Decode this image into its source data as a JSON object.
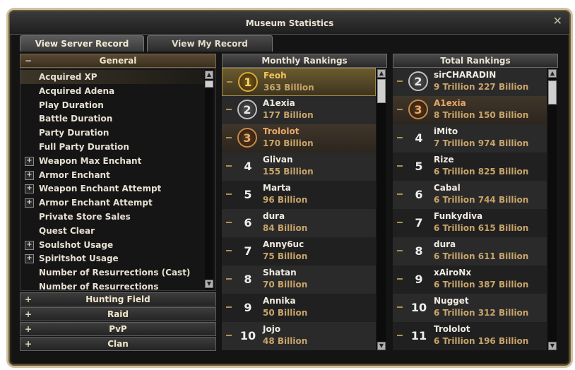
{
  "window": {
    "title": "Museum Statistics",
    "close_glyph": "✕"
  },
  "tabs": [
    {
      "label": "View Server Record",
      "active": true
    },
    {
      "label": "View My Record",
      "active": false
    }
  ],
  "left": {
    "general_header": "General",
    "general_sign": "−",
    "items": [
      {
        "label": "Acquired XP",
        "plus": false,
        "selected": true
      },
      {
        "label": "Acquired Adena",
        "plus": false
      },
      {
        "label": "Play Duration",
        "plus": false
      },
      {
        "label": "Battle Duration",
        "plus": false
      },
      {
        "label": "Party Duration",
        "plus": false
      },
      {
        "label": "Full Party Duration",
        "plus": false
      },
      {
        "label": "Weapon Max Enchant",
        "plus": true
      },
      {
        "label": "Armor Enchant",
        "plus": true
      },
      {
        "label": "Weapon Enchant Attempt",
        "plus": true
      },
      {
        "label": "Armor Enchant Attempt",
        "plus": true
      },
      {
        "label": "Private Store Sales",
        "plus": false
      },
      {
        "label": "Quest Clear",
        "plus": false
      },
      {
        "label": "Soulshot Usage",
        "plus": true
      },
      {
        "label": "Spiritshot Usage",
        "plus": true
      },
      {
        "label": "Number of Resurrections (Cast)",
        "plus": false
      },
      {
        "label": "Number of Resurrections (Received)",
        "plus": false
      }
    ],
    "categories": [
      {
        "label": "Hunting Field",
        "sign": "+"
      },
      {
        "label": "Raid",
        "sign": "+"
      },
      {
        "label": "PvP",
        "sign": "+"
      },
      {
        "label": "Clan",
        "sign": "+"
      }
    ]
  },
  "monthly": {
    "header": "Monthly Rankings",
    "rows": [
      {
        "rank": "1",
        "name": "Feoh",
        "value": "363 Billion",
        "medal": "m1",
        "style": "gold",
        "name_style": "hl"
      },
      {
        "rank": "2",
        "name": "A1exia",
        "value": "177 Billion",
        "medal": "m2",
        "style": "odd",
        "name_style": ""
      },
      {
        "rank": "3",
        "name": "Trololot",
        "value": "170 Billion",
        "medal": "m3",
        "style": "bronze",
        "name_style": "hl2"
      },
      {
        "rank": "4",
        "name": "Glivan",
        "value": "155 Billion",
        "style": "odd"
      },
      {
        "rank": "5",
        "name": "Marta",
        "value": "96 Billion",
        "style": "even"
      },
      {
        "rank": "6",
        "name": "dura",
        "value": "84 Billion",
        "style": "odd"
      },
      {
        "rank": "7",
        "name": "Anny6uc",
        "value": "75 Billion",
        "style": "even"
      },
      {
        "rank": "8",
        "name": "Shatan",
        "value": "70 Billion",
        "style": "odd"
      },
      {
        "rank": "9",
        "name": "Annika",
        "value": "50 Billion",
        "style": "even"
      },
      {
        "rank": "10",
        "name": "Jojo",
        "value": "48 Billion",
        "style": "odd"
      }
    ]
  },
  "total": {
    "header": "Total Rankings",
    "rows": [
      {
        "rank": "2",
        "name": "sirCHARADIN",
        "value": "9 Trillion 227 Billion",
        "medal": "m2",
        "style": "odd",
        "name_style": ""
      },
      {
        "rank": "3",
        "name": "A1exia",
        "value": "8 Trillion 150 Billion",
        "medal": "m3",
        "style": "bronze",
        "name_style": "hl2"
      },
      {
        "rank": "4",
        "name": "iMito",
        "value": "7 Trillion 974 Billion",
        "style": "odd"
      },
      {
        "rank": "5",
        "name": "Rize",
        "value": "6 Trillion 825 Billion",
        "style": "even"
      },
      {
        "rank": "6",
        "name": "Cabal",
        "value": "6 Trillion 744 Billion",
        "style": "odd"
      },
      {
        "rank": "7",
        "name": "Funkydiva",
        "value": "6 Trillion 615 Billion",
        "style": "even"
      },
      {
        "rank": "8",
        "name": "dura",
        "value": "6 Trillion 611 Billion",
        "style": "odd"
      },
      {
        "rank": "9",
        "name": "xAiroNx",
        "value": "6 Trillion 387 Billion",
        "style": "even"
      },
      {
        "rank": "10",
        "name": "Nugget",
        "value": "6 Trillion 312 Billion",
        "style": "odd"
      },
      {
        "rank": "11",
        "name": "Trololot",
        "value": "6 Trillion 196 Billion",
        "style": "even"
      }
    ]
  },
  "scroll": {
    "up": "▲",
    "down": "▼"
  }
}
